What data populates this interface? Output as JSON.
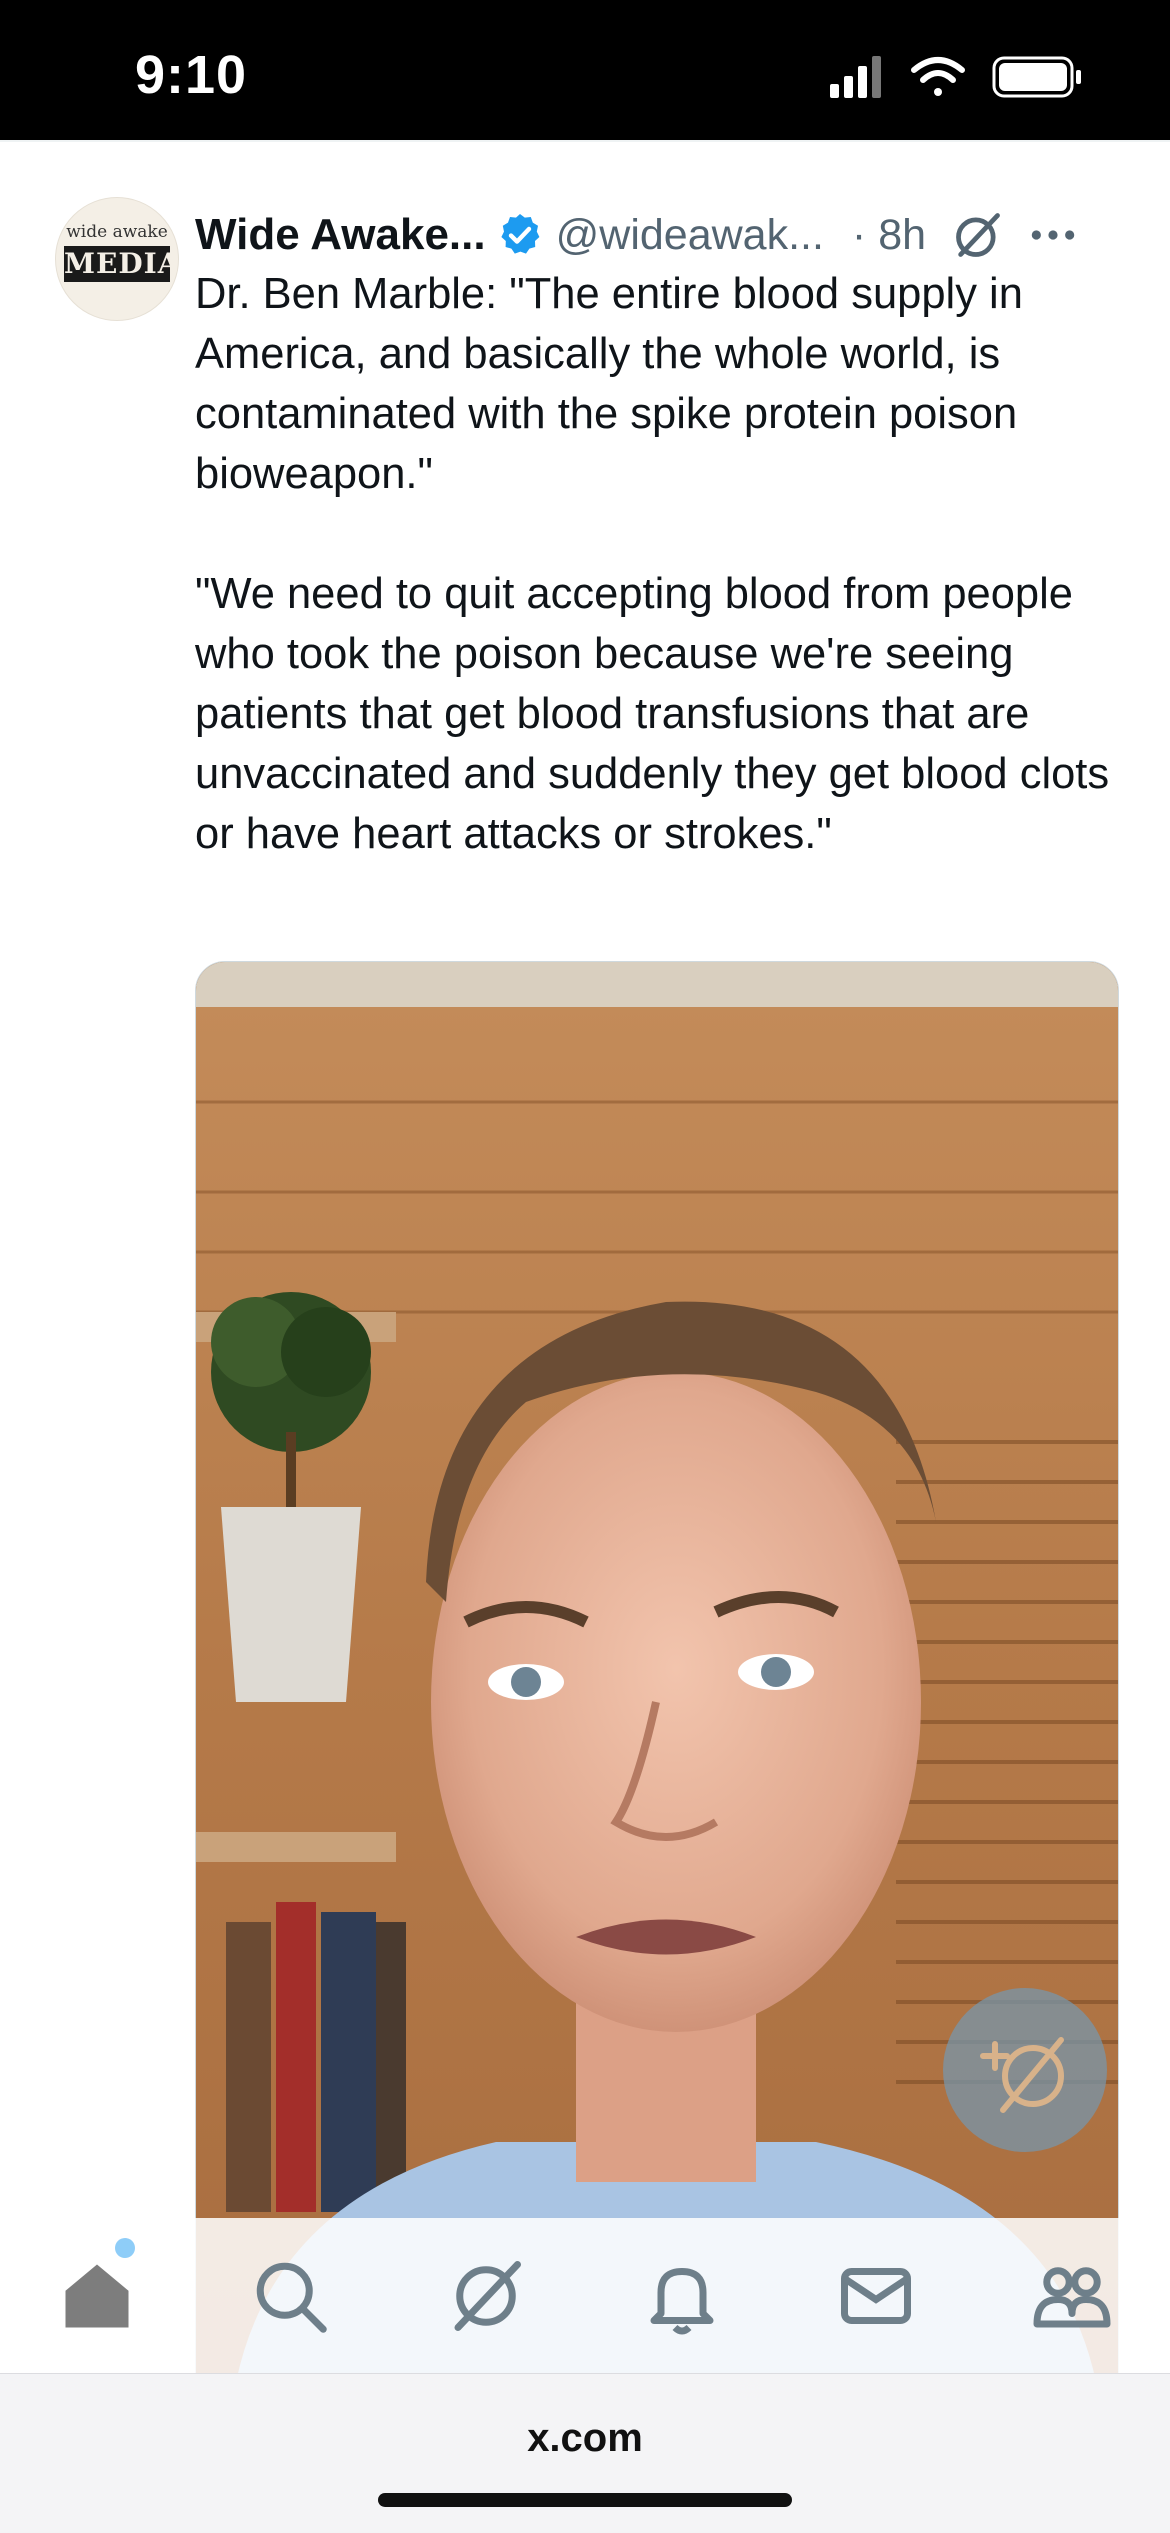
{
  "status_bar": {
    "time": "9:10"
  },
  "tweet": {
    "avatar_text_top": "wide awake",
    "avatar_text_main": "MEDIA",
    "display_name": "Wide Awake...",
    "handle": "@wideawak...",
    "time": "· 8h",
    "paragraphs": [
      "Dr. Ben Marble: \"The entire blood supply in America, and basically the whole world, is contaminated with the spike protein poison bioweapon.\"",
      "\"We need to quit accepting blood from people who took the poison because we're seeing patients that get blood transfusions that are unvaccinated and suddenly they get blood clots or have heart attacks or strokes.\""
    ]
  },
  "icons": {
    "verified": "verified-badge-icon",
    "grok": "grok-icon",
    "more": "more-icon",
    "compose": "grok-compose-icon"
  },
  "tabbar": {
    "items": [
      "home",
      "search",
      "grok",
      "notifications",
      "messages",
      "communities"
    ]
  },
  "browser": {
    "url": "x.com"
  },
  "colors": {
    "accent": "#1d9bf0",
    "text": "#0f1419",
    "secondary": "#536471"
  }
}
